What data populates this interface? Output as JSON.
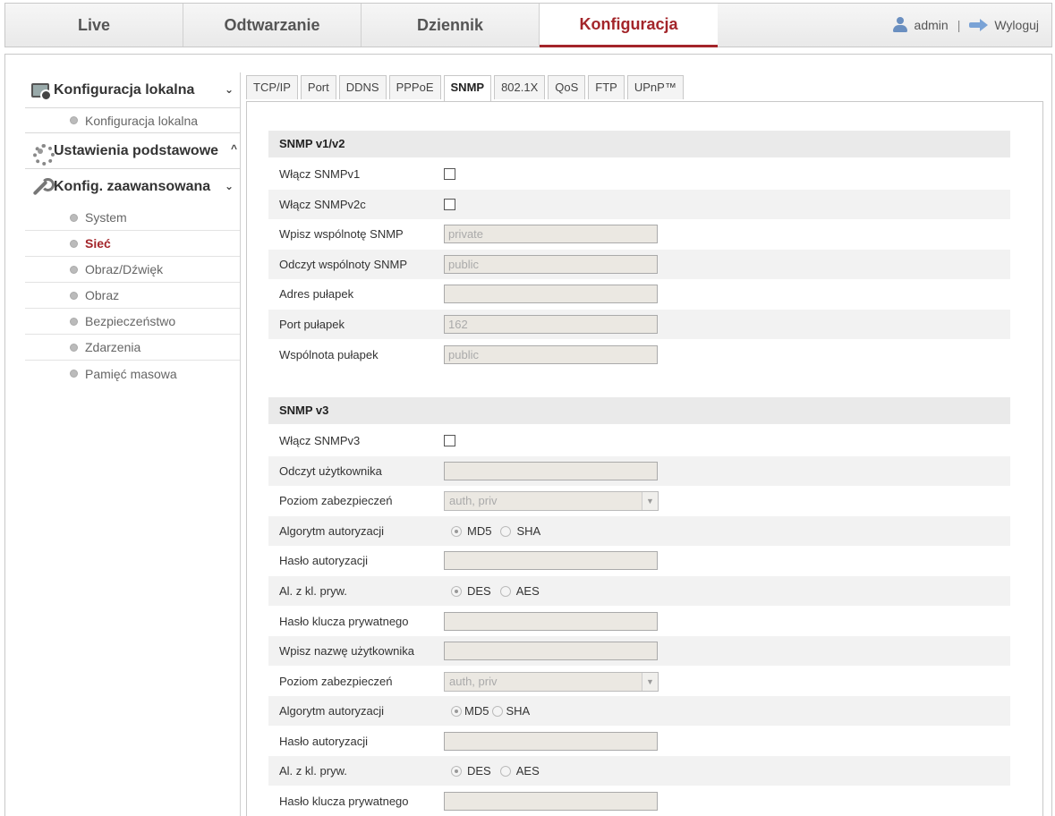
{
  "topnav": {
    "tabs": [
      "Live",
      "Odtwarzanie",
      "Dziennik",
      "Konfiguracja"
    ],
    "user": "admin",
    "separator": "|",
    "logout": "Wyloguj"
  },
  "sidebar": {
    "group_local": "Konfiguracja lokalna",
    "item_local": "Konfiguracja lokalna",
    "group_basic": "Ustawienia podstawowe",
    "group_advanced": "Konfig. zaawansowana",
    "chevron_down": "⌄",
    "chevron_up": "^",
    "items": [
      "System",
      "Sieć",
      "Obraz/Dźwięk",
      "Obraz",
      "Bezpieczeństwo",
      "Zdarzenia",
      "Pamięć masowa"
    ]
  },
  "tabs": [
    "TCP/IP",
    "Port",
    "DDNS",
    "PPPoE",
    "SNMP",
    "802.1X",
    "QoS",
    "FTP",
    "UPnP™"
  ],
  "v12": {
    "title": "SNMP v1/v2",
    "enable_v1": "Włącz SNMPv1",
    "enable_v2c": "Włącz SNMPv2c",
    "write_community": "Wpisz wspólnotę SNMP",
    "write_community_value": "private",
    "read_community": "Odczyt wspólnoty SNMP",
    "read_community_value": "public",
    "trap_address": "Adres pułapek",
    "trap_address_value": "",
    "trap_port": "Port pułapek",
    "trap_port_value": "162",
    "trap_community": "Wspólnota pułapek",
    "trap_community_value": "public"
  },
  "v3": {
    "title": "SNMP v3",
    "enable_v3": "Włącz SNMPv3",
    "read_user": "Odczyt użytkownika",
    "security_level": "Poziom zabezpieczeń",
    "security_value": "auth, priv",
    "auth_algo": "Algorytm autoryzacji",
    "md5": "MD5",
    "sha": "SHA",
    "auth_pass": "Hasło autoryzacji",
    "priv_algo": "Al. z kl. pryw.",
    "des": "DES",
    "aes": "AES",
    "priv_key_pass": "Hasło klucza prywatnego",
    "write_user": "Wpisz nazwę użytkownika"
  }
}
